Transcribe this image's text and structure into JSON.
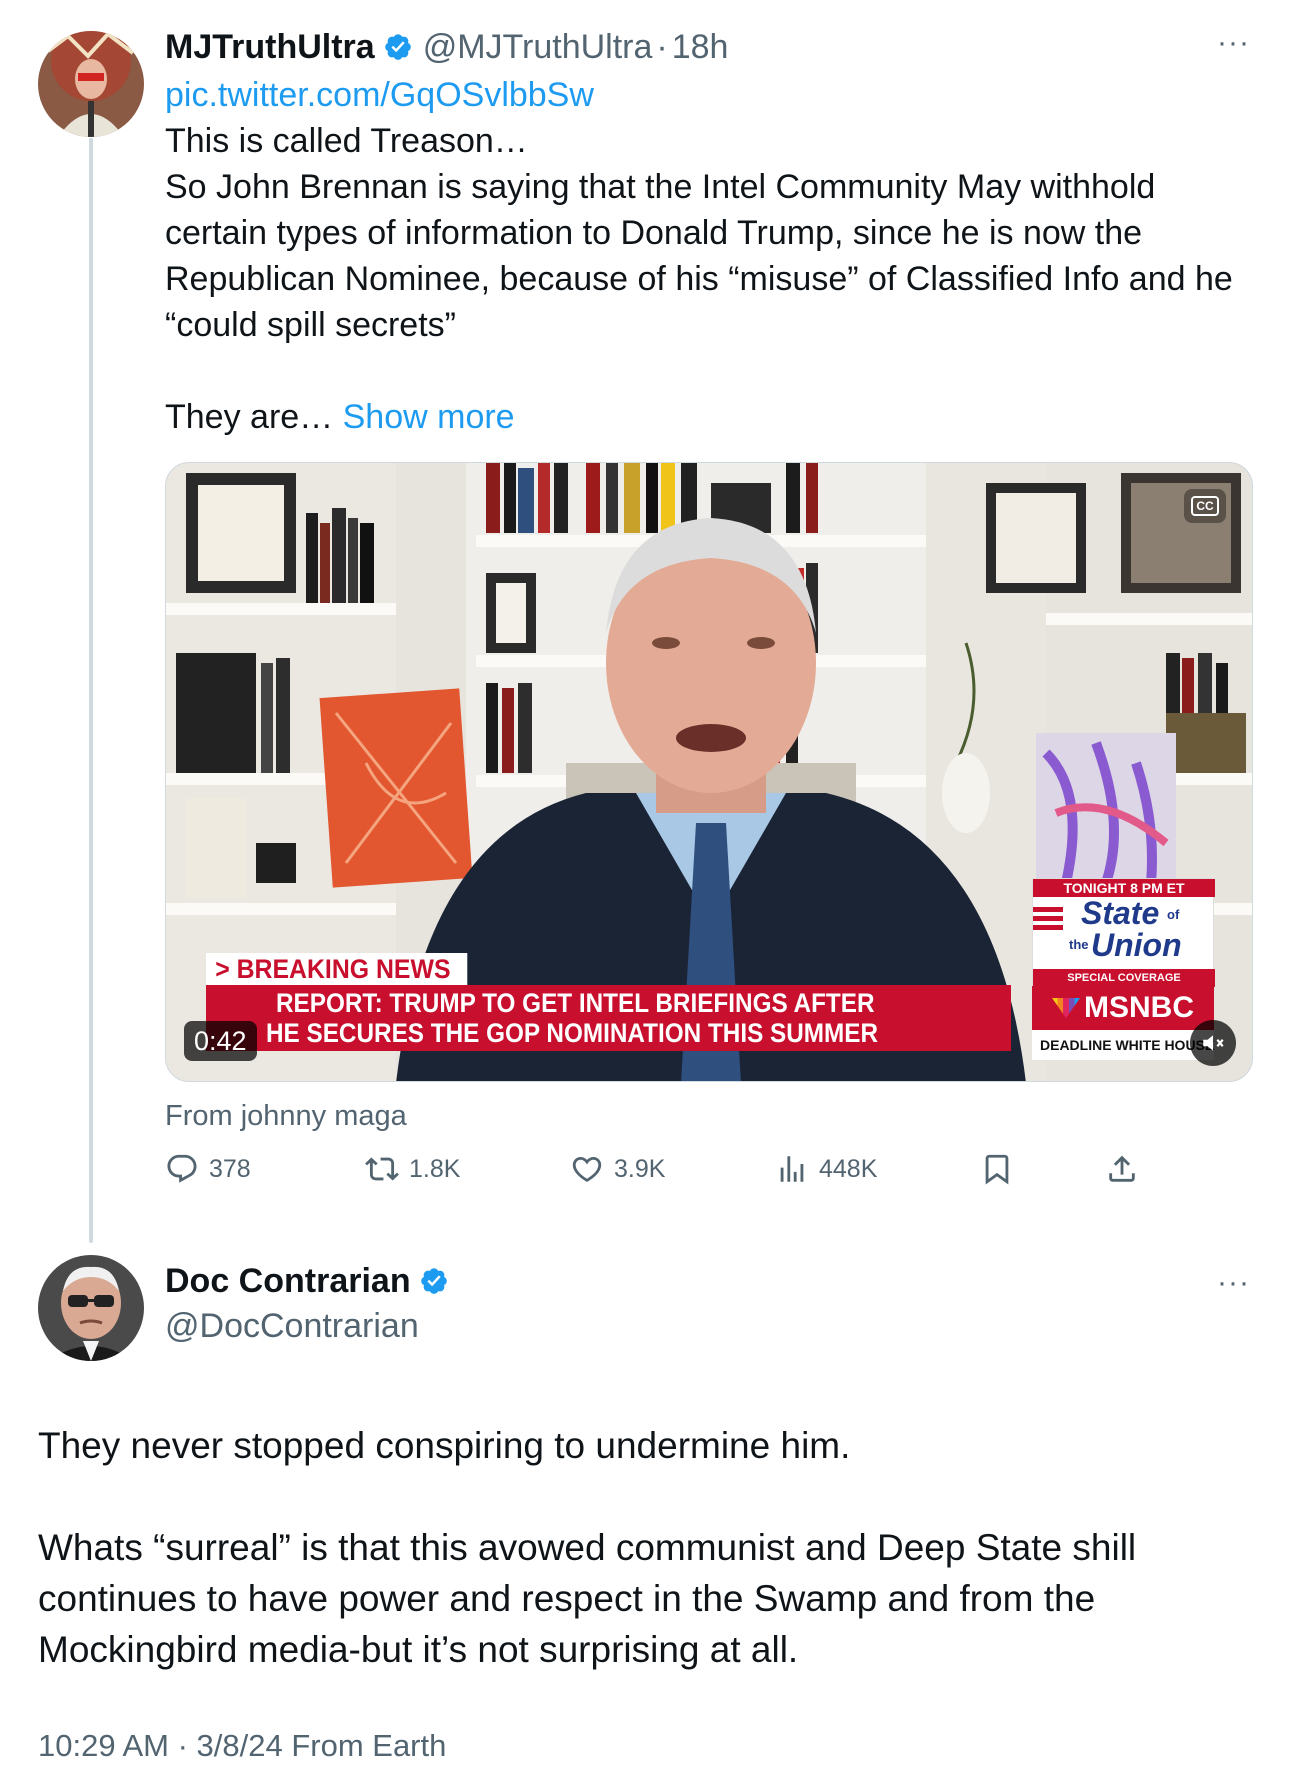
{
  "tweet1": {
    "name": "MJTruthUltra",
    "handle": "@MJTruthUltra",
    "separator": "·",
    "time": "18h",
    "more": "···",
    "link": "pic.twitter.com/GqOSvlbbSw",
    "lines": [
      "This is called Treason…",
      "So John Brennan is saying that the Intel Community May withhold",
      "certain types of information to Donald Trump, since he is now the",
      "Republican Nominee, because of his “misuse” of Classified Info and he",
      "“could spill secrets”"
    ],
    "truncated_text": "They are… ",
    "show_more": "Show more",
    "video": {
      "duration": "0:42",
      "breaking_label": "> BREAKING NEWS",
      "headline_line1": "REPORT: TRUMP TO GET INTEL BRIEFINGS AFTER",
      "headline_line2": "HE SECURES THE GOP NOMINATION THIS SUMMER",
      "promo_time": "TONIGHT 8 PM ET",
      "promo_title_a": "State",
      "promo_title_of": "of",
      "promo_title_the": "the",
      "promo_title_b": "Union",
      "promo_sub": "SPECIAL COVERAGE",
      "network": "MSNBC",
      "show_name": "DEADLINE  WHITE HOUSE",
      "cc_label": "CC"
    },
    "from_label": "From johnny maga",
    "stats": {
      "replies": "378",
      "retweets": "1.8K",
      "likes": "3.9K",
      "views": "448K"
    }
  },
  "tweet2": {
    "name": "Doc Contrarian",
    "handle": "@DocContrarian",
    "more": "···",
    "para1": "They never stopped conspiring to undermine him.",
    "para2_lines": [
      "Whats “surreal” is that this avowed communist and Deep State shill",
      "continues to have power and respect in the Swamp and from the",
      "Mockingbird media-but it’s not surprising at all."
    ],
    "footer": "10:29 AM · 3/8/24 From Earth"
  },
  "colors": {
    "text": "#0f1419",
    "secondary": "#536471",
    "link": "#1d9bf0",
    "verified": "#1d9bf0",
    "breaking_red": "#c8102e"
  }
}
